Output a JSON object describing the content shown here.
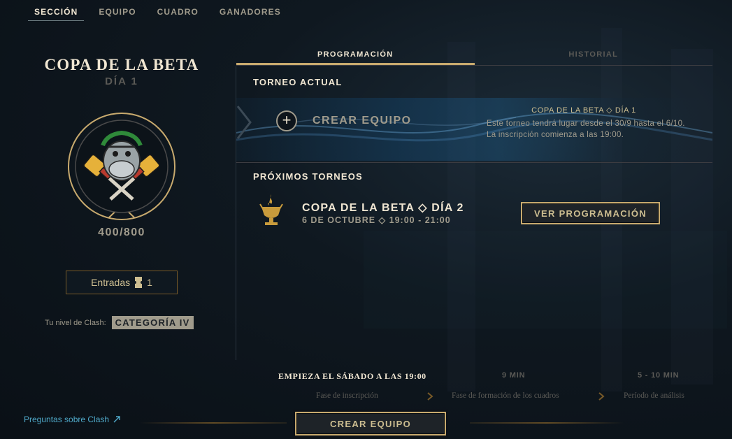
{
  "nav": {
    "items": [
      {
        "label": "SECCIÓN",
        "active": true
      },
      {
        "label": "EQUIPO",
        "active": false
      },
      {
        "label": "CUADRO",
        "active": false
      },
      {
        "label": "GANADORES",
        "active": false
      }
    ]
  },
  "left": {
    "title": "COPA DE LA BETA",
    "day": "DÍA 1",
    "points": "400/800",
    "tickets_label": "Entradas",
    "tickets_count": "1",
    "clash_level_label": "Tu nivel de Clash:",
    "clash_level_value": "CATEGORÍA IV"
  },
  "tabs": [
    {
      "label": "PROGRAMACIÓN",
      "active": true
    },
    {
      "label": "HISTORIAL",
      "active": false
    }
  ],
  "current": {
    "heading": "TORNEO ACTUAL",
    "create_label": "CREAR EQUIPO",
    "info_title": "COPA DE LA BETA ◇ DÍA 1",
    "info_desc": "Este torneo tendrá lugar desde el 30/9 hasta el 6/10. La inscripción comienza a las 19:00."
  },
  "upcoming": {
    "heading": "PRÓXIMOS TORNEOS",
    "name": "COPA DE LA BETA ◇ DÍA 2",
    "date": "6 DE OCTUBRE ◇ 19:00 - 21:00",
    "schedule_button": "VER PROGRAMACIÓN"
  },
  "phases": [
    {
      "head": "EMPIEZA EL SÁBADO A LAS 19:00",
      "label": "Fase de inscripción"
    },
    {
      "head": "9 MIN",
      "label": "Fase de formación de los cuadros"
    },
    {
      "head": "5 - 10 MIN",
      "label": "Período de análisis"
    }
  ],
  "footer": {
    "faq_link": "Preguntas sobre Clash",
    "create_button": "CREAR EQUIPO"
  },
  "colors": {
    "gold": "#c8aa6e",
    "gold_light": "#f0e6d2",
    "muted": "#a09b8c",
    "link": "#4fa9c9"
  }
}
